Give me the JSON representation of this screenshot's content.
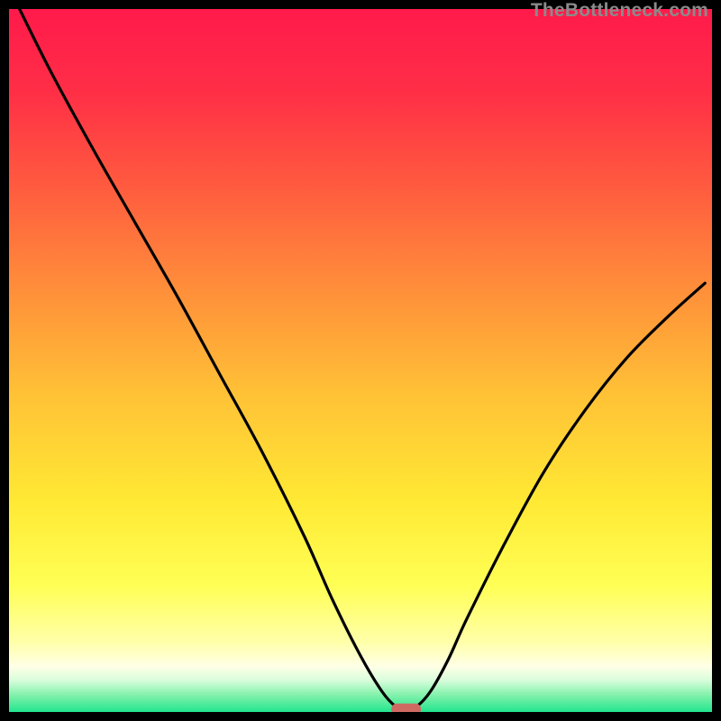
{
  "watermark": "TheBottleneck.com",
  "colors": {
    "gradient_stops": [
      {
        "offset": 0.0,
        "color": "#ff1a4b"
      },
      {
        "offset": 0.12,
        "color": "#ff2f46"
      },
      {
        "offset": 0.25,
        "color": "#ff5a3f"
      },
      {
        "offset": 0.4,
        "color": "#ff8f3a"
      },
      {
        "offset": 0.55,
        "color": "#ffc236"
      },
      {
        "offset": 0.7,
        "color": "#ffe934"
      },
      {
        "offset": 0.82,
        "color": "#ffff55"
      },
      {
        "offset": 0.9,
        "color": "#ffffa8"
      },
      {
        "offset": 0.935,
        "color": "#ffffe6"
      },
      {
        "offset": 0.955,
        "color": "#d8fddb"
      },
      {
        "offset": 0.975,
        "color": "#86f2ad"
      },
      {
        "offset": 1.0,
        "color": "#22e58e"
      }
    ],
    "curve_stroke": "#000000",
    "marker_fill": "#cf6a63",
    "page_bg": "#000000"
  },
  "chart_data": {
    "type": "line",
    "title": "",
    "xlabel": "",
    "ylabel": "",
    "xlim": [
      0,
      100
    ],
    "ylim": [
      0,
      100
    ],
    "grid": false,
    "legend": false,
    "axes_visible": false,
    "note": "Axes are implicit; values are percent-of-plot coordinates estimated from the image. y=0 is the bottom (green) edge.",
    "series": [
      {
        "name": "bottleneck-curve",
        "x": [
          1.5,
          6,
          12,
          18,
          24,
          30,
          36,
          42,
          46,
          50,
          53,
          55,
          56.5,
          58,
          60,
          62.5,
          65,
          70,
          76,
          82,
          88,
          94,
          99
        ],
        "y": [
          100,
          91,
          80,
          69.5,
          59,
          48,
          37,
          25,
          16,
          8,
          3,
          0.8,
          0.4,
          0.8,
          3,
          7.5,
          13,
          23,
          34,
          43,
          50.5,
          56.5,
          61
        ]
      }
    ],
    "annotations": [
      {
        "name": "min-marker",
        "shape": "rounded-rect",
        "x": 56.5,
        "y": 0.4,
        "width_pct": 4.2,
        "height_pct": 1.6
      }
    ]
  }
}
